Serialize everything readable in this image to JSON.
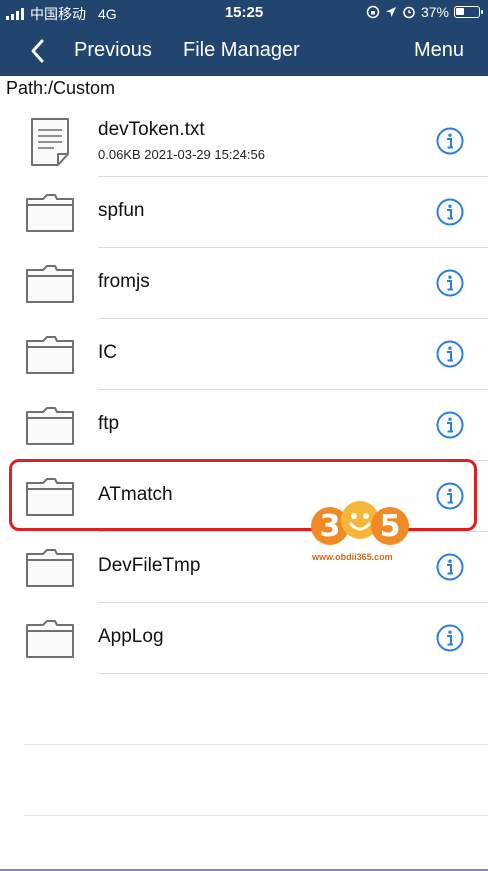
{
  "status_bar": {
    "carrier": "中国移动",
    "network": "4G",
    "time": "15:25",
    "battery_percent": "37%",
    "battery_level": 0.37
  },
  "nav": {
    "back_label": "Previous",
    "title": "File Manager",
    "menu_label": "Menu"
  },
  "path": "Path:/Custom",
  "files": [
    {
      "name": "devToken.txt",
      "type": "file",
      "meta": "0.06KB 2021-03-29 15:24:56"
    },
    {
      "name": "spfun",
      "type": "folder"
    },
    {
      "name": "fromjs",
      "type": "folder"
    },
    {
      "name": "IC",
      "type": "folder"
    },
    {
      "name": "ftp",
      "type": "folder"
    },
    {
      "name": "ATmatch",
      "type": "folder",
      "highlighted": true
    },
    {
      "name": "DevFileTmp",
      "type": "folder"
    },
    {
      "name": "AppLog",
      "type": "folder"
    }
  ],
  "watermark": {
    "logo_text": "365",
    "url": "www.obdii365.com"
  },
  "colors": {
    "header_bg": "#21456e",
    "info_icon": "#2a7de1",
    "highlight_border": "#e02020"
  }
}
